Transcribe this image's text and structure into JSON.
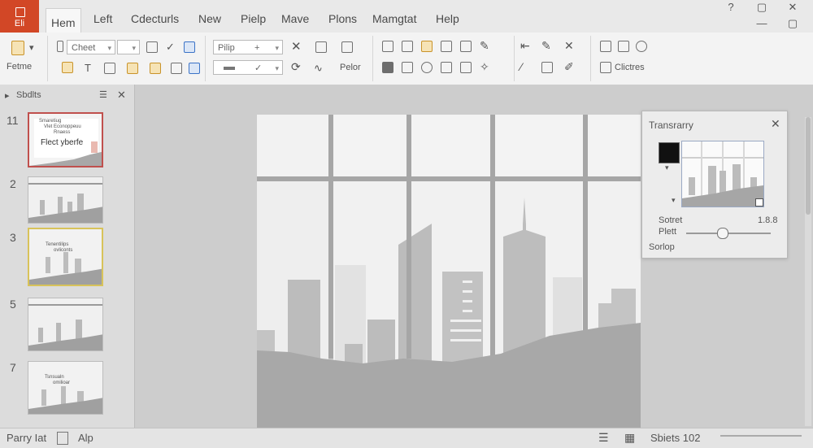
{
  "app": {
    "file_tab": "Eli"
  },
  "tabs": [
    "Hem",
    "Left",
    "Cdecturls",
    "New",
    "Pielp",
    "Mave",
    "Plons",
    "Mamgtat",
    "Help"
  ],
  "window_controls": {
    "help": "?",
    "minimize": "—",
    "restore": "▢",
    "close": "✕"
  },
  "ribbon": {
    "paste_label": "Fetme",
    "font_name": "Cheet",
    "font_size": "Pilip",
    "arrange_label": "Pelor",
    "styles_label": "Clictres"
  },
  "thumb_panel": {
    "title": "Sbdlts",
    "numbers": [
      "11",
      "2",
      "3",
      "5",
      "7"
    ],
    "slide1_lines": [
      "Smaretiug",
      "Vlet Econoppeuu",
      "Rnaess"
    ],
    "slide1_big": "Flect yberfe",
    "slide3_lines": [
      "Tenentilips",
      "ovliconts"
    ],
    "slide7_lines": [
      "Tsnsualn",
      "omilioar"
    ]
  },
  "transparency_pane": {
    "title": "Transrarry",
    "close": "✕",
    "label_sotret": "Sotret",
    "value_sotret": "1.8.8",
    "label_plett": "Plett",
    "label_sorlop": "Sorlop"
  },
  "status_bar": {
    "left_text": "Parry Iat",
    "center_text": "Alp",
    "slide_info": "Sbiets 102"
  },
  "colors": {
    "file_tab": "#d24726",
    "selected_slide_border": "#c0504d",
    "selected_slide3_border": "#d8c35a"
  }
}
